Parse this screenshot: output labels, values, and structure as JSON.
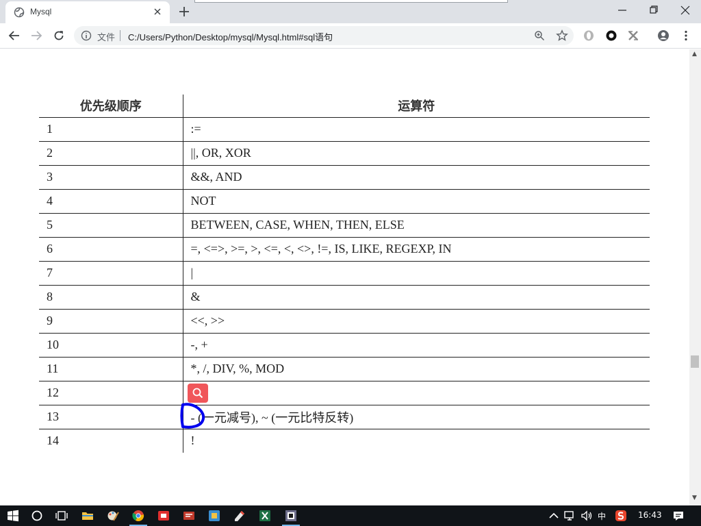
{
  "browser": {
    "tab_title": "Mysql",
    "omnibox_scheme": "文件",
    "url": "C:/Users/Python/Desktop/mysql/Mysql.html#sql语句"
  },
  "table": {
    "headers": [
      "优先级顺序",
      "运算符"
    ],
    "rows": [
      [
        "1",
        ":="
      ],
      [
        "2",
        "||, OR, XOR"
      ],
      [
        "3",
        "&&, AND"
      ],
      [
        "4",
        "NOT"
      ],
      [
        "5",
        "BETWEEN, CASE, WHEN, THEN, ELSE"
      ],
      [
        "6",
        "=, <=>, >=, >, <=, <, <>, !=, IS, LIKE, REGEXP, IN"
      ],
      [
        "7",
        "|"
      ],
      [
        "8",
        "&"
      ],
      [
        "9",
        "<<, >>"
      ],
      [
        "10",
        "-, +"
      ],
      [
        "11",
        "*, /, DIV, %, MOD"
      ],
      [
        "12",
        ""
      ],
      [
        "13",
        "- (一元减号), ~ (一元比特反转)"
      ],
      [
        "14",
        "!"
      ]
    ]
  },
  "taskbar": {
    "ime": "中",
    "clock": "16:43"
  },
  "colors": {
    "accent_search_badge": "#f0565a",
    "pen_annotation": "#0000ee"
  }
}
